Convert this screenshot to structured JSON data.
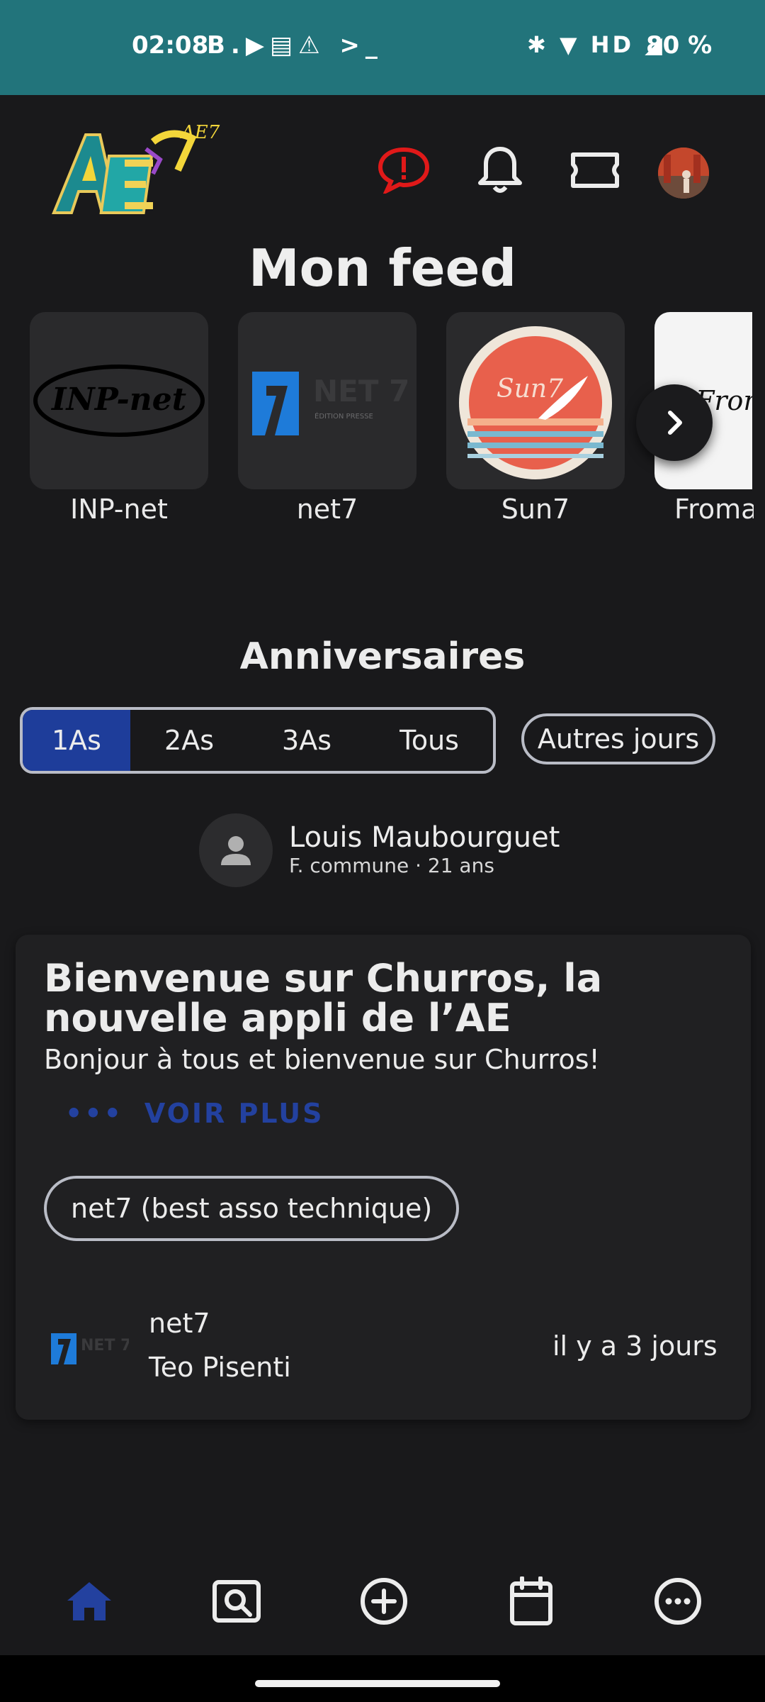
{
  "status_bar": {
    "time": "02:08",
    "notif_icons": "B.▶▤⚠ >_",
    "system_icons": "✱ ▼ HD ◢",
    "battery": "80 %",
    "bg_color": "#22747b"
  },
  "header": {
    "logo_text": "AE7",
    "icons": [
      "alert-bubble-icon",
      "bell-icon",
      "ticket-icon",
      "avatar"
    ],
    "alert_color": "#e01919"
  },
  "feed": {
    "title": "Mon feed"
  },
  "groups": [
    {
      "name": "INP-net",
      "logo_text": "INP-net"
    },
    {
      "name": "net7",
      "logo_text": "NET 7",
      "logo_sub": "ÉDITION PRESSE"
    },
    {
      "name": "Sun7",
      "logo_text": "Sun7"
    },
    {
      "name": "Froma",
      "logo_text": "Froma"
    }
  ],
  "birthdays": {
    "title": "Anniversaires",
    "tabs": [
      "1As",
      "2As",
      "3As",
      "Tous"
    ],
    "active_tab": "1As",
    "other_days": "Autres jours",
    "person": {
      "name": "Louis Maubourguet",
      "detail": "F. commune · 21 ans"
    }
  },
  "article": {
    "title": "Bienvenue sur Churros, la nouvelle appli de l’AE",
    "body": "Bonjour à tous et bienvenue sur Churros!",
    "voir_plus": "VOIR PLUS",
    "voir_plus_dots": "•••",
    "tag": "net7 (best asso technique)",
    "group": "net7",
    "author": "Teo Pisenti",
    "date": "il y a 3 jours",
    "accent": "#23419f"
  },
  "bottom_nav": {
    "items": [
      "home-icon",
      "search-icon",
      "add-icon",
      "calendar-icon",
      "more-icon"
    ],
    "active": "home-icon",
    "active_color": "#23419f"
  }
}
